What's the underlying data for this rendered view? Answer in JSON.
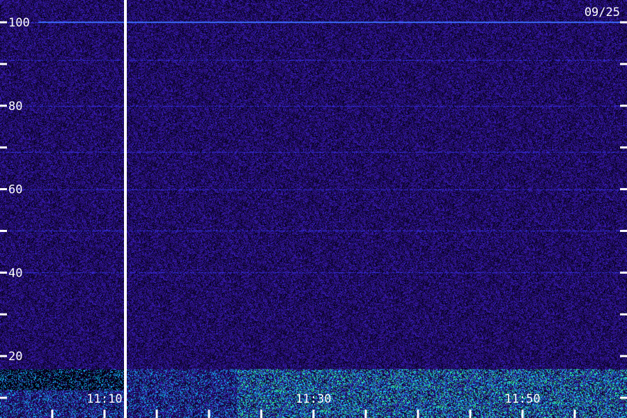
{
  "chart_data": {
    "type": "heatmap",
    "title": "",
    "date_label": "09/25",
    "xlabel": "",
    "ylabel": "",
    "y_ticks_major": [
      20,
      40,
      60,
      80,
      100
    ],
    "y_ticks_minor": [
      10,
      30,
      50,
      70,
      90
    ],
    "ylim": [
      10,
      105
    ],
    "x_tick_labels": [
      "11:10",
      "11:30",
      "11:50"
    ],
    "x_minor_ticks": [
      "11:05",
      "11:10",
      "11:15",
      "11:20",
      "11:25",
      "11:30",
      "11:35",
      "11:40",
      "11:45",
      "11:50",
      "11:55"
    ],
    "xlim": [
      "11:05",
      "11:59"
    ],
    "marker_line_time": "11:12",
    "colormap": [
      "#000000",
      "#1a0a4a",
      "#3a1ab0",
      "#2040ff",
      "#20c0ff",
      "#40ff80"
    ],
    "persistent_lines": [
      100,
      91,
      80,
      69,
      60,
      50,
      40
    ],
    "noise_floor_top": 17
  }
}
